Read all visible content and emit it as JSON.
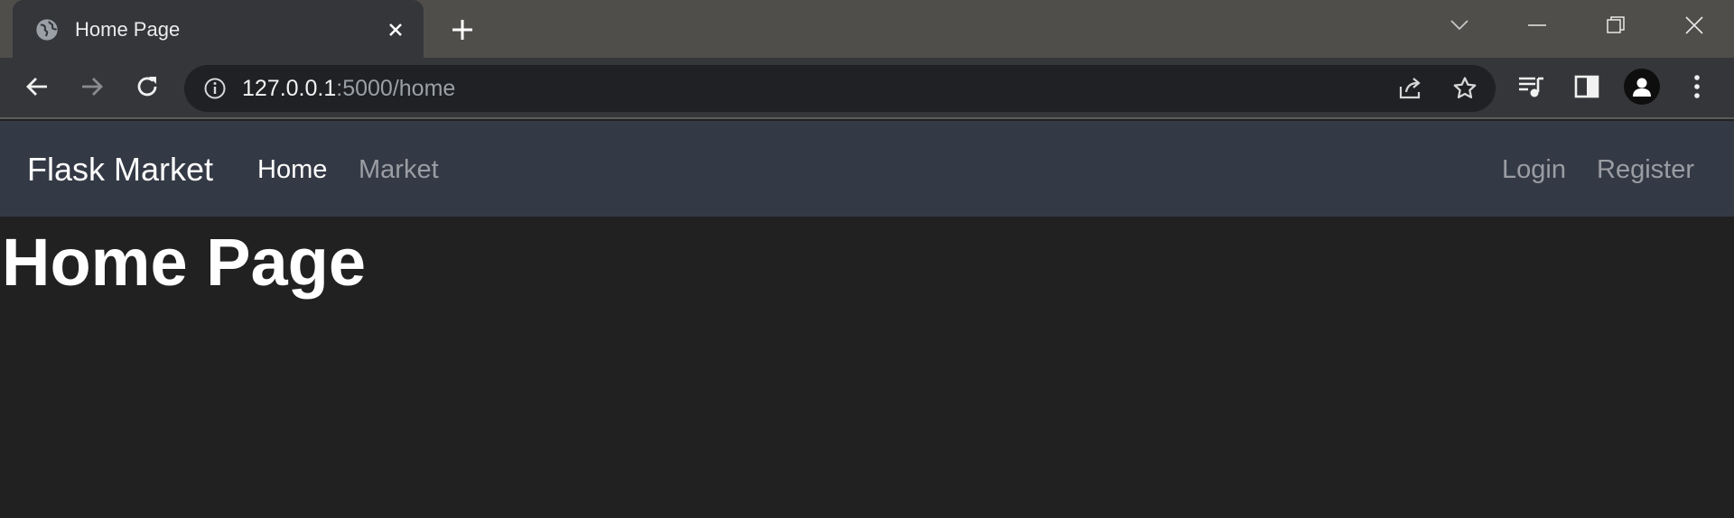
{
  "browser": {
    "tab": {
      "title": "Home Page",
      "favicon": "globe-icon"
    },
    "address_bar": {
      "url_host": "127.0.0.1",
      "url_rest": ":5000/home"
    },
    "icons": {
      "back": "arrow-left-icon",
      "forward": "arrow-right-icon",
      "reload": "reload-icon",
      "site_info": "info-icon",
      "share": "share-icon",
      "bookmark": "star-icon",
      "media": "media-playlist-icon",
      "side_panel": "side-panel-icon",
      "profile": "profile-icon",
      "menu": "kebab-menu-icon",
      "tab_search": "chevron-down-icon",
      "minimize": "minimize-icon",
      "restore": "restore-icon",
      "close": "close-icon"
    }
  },
  "site": {
    "brand": "Flask Market",
    "nav": {
      "home": "Home",
      "market": "Market",
      "login": "Login",
      "register": "Register"
    }
  },
  "main": {
    "heading": "Home Page"
  },
  "colors": {
    "page_background": "#212121",
    "navbar_background": "#343a45",
    "active_link": "#ffffff",
    "inactive_link": "#9a9da3"
  }
}
